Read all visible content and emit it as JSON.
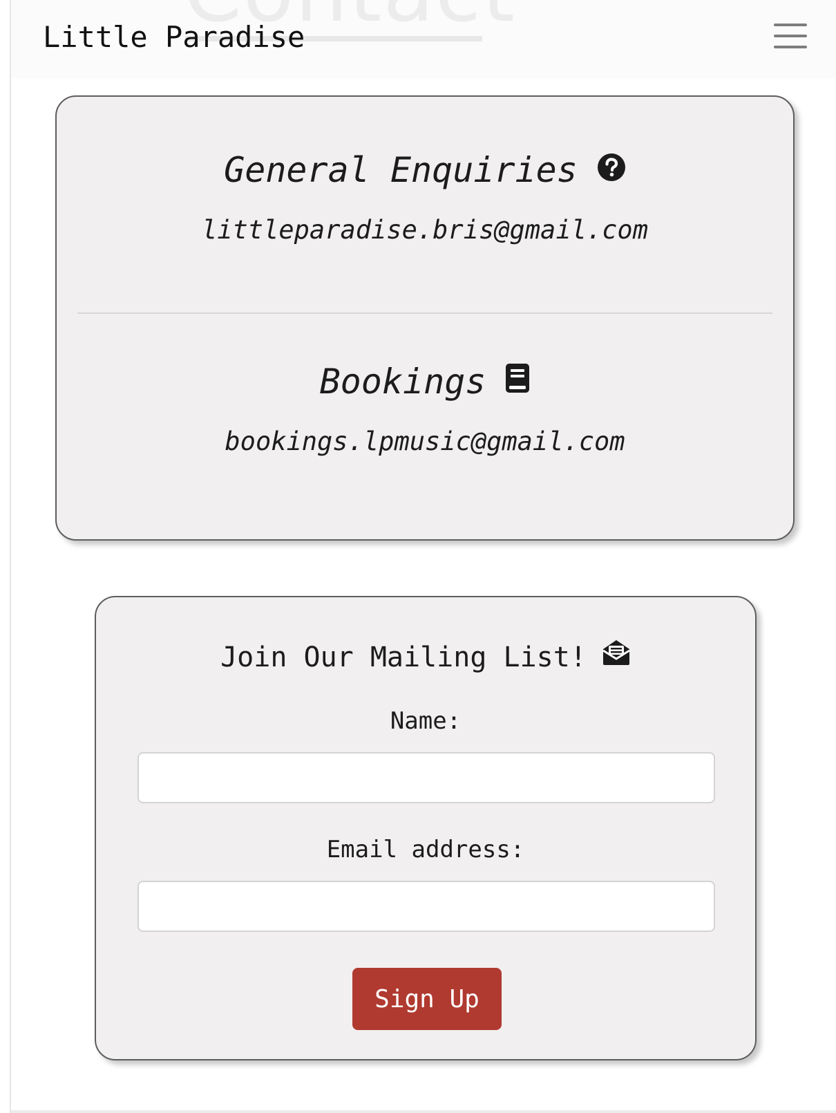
{
  "navbar": {
    "brand": "Little Paradise",
    "page_heading": "Contact",
    "menu_icon": "hamburger-menu-icon"
  },
  "contact": {
    "general": {
      "title": "General Enquiries",
      "icon": "question-circle-icon",
      "email": "littleparadise.bris@gmail.com"
    },
    "bookings": {
      "title": "Bookings",
      "icon": "book-icon",
      "email": "bookings.lpmusic@gmail.com"
    }
  },
  "mailing": {
    "title": "Join Our Mailing List!",
    "icon": "envelope-open-icon",
    "name_label": "Name:",
    "name_value": "",
    "email_label": "Email address:",
    "email_value": "",
    "submit_label": "Sign Up"
  },
  "colors": {
    "card_background": "#f1eff0",
    "card_border": "#5d5d5d",
    "button": "#b03a30",
    "text": "#1c1c1c"
  }
}
